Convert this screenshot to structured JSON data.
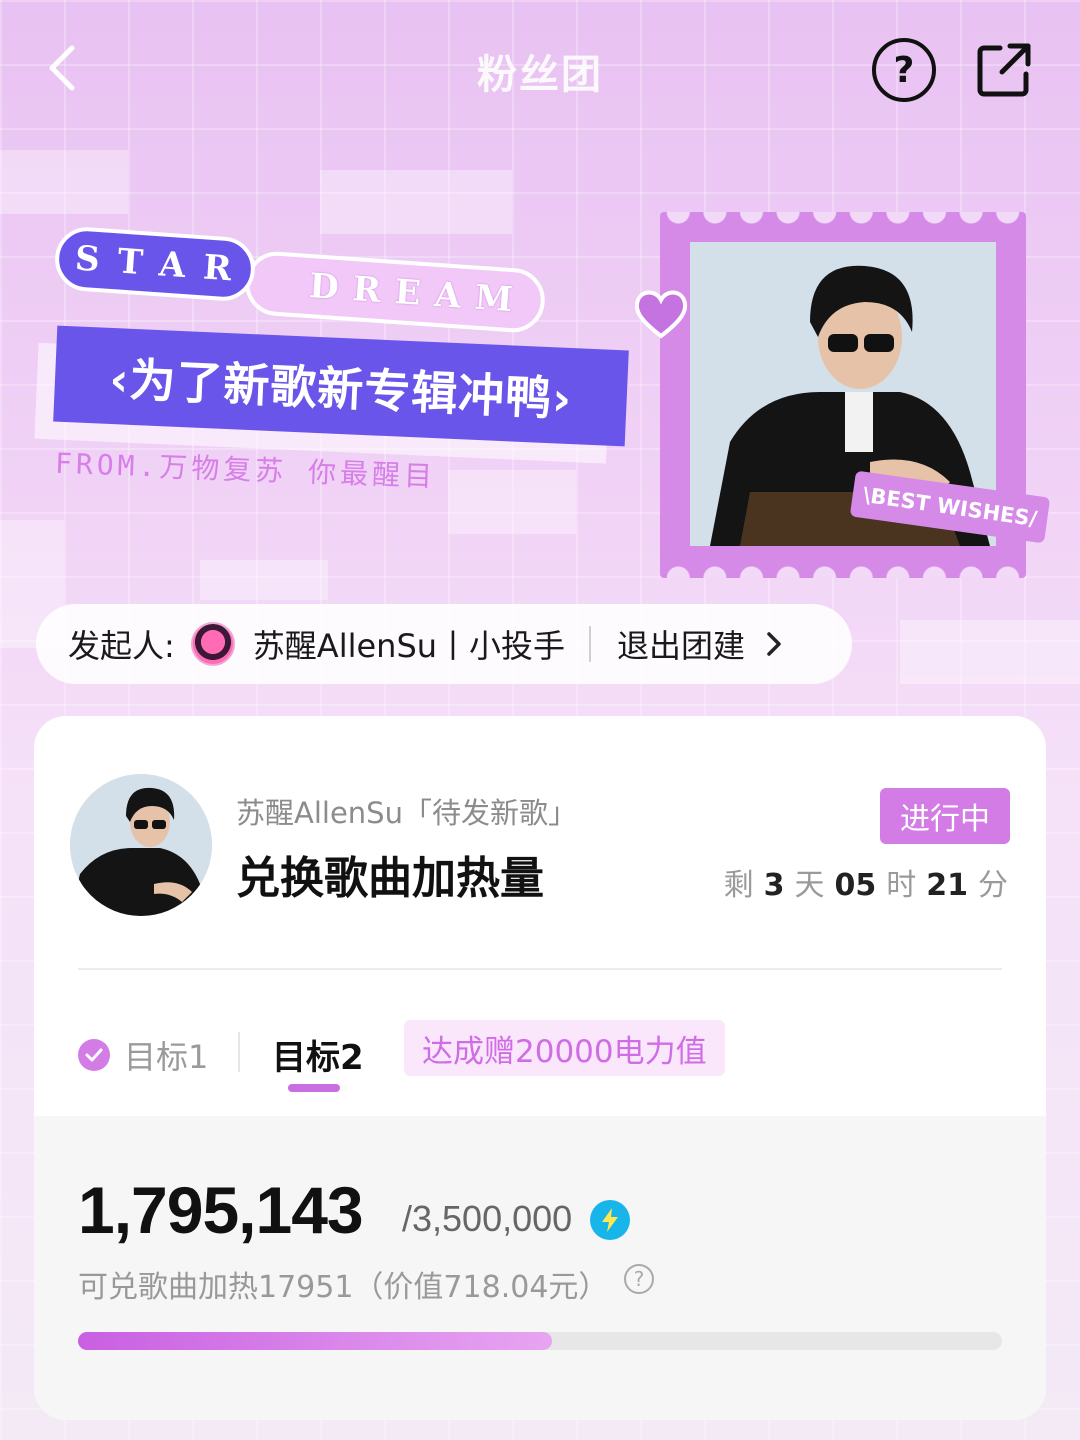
{
  "header": {
    "title": "粉丝团",
    "back_icon": "chevron-left-icon",
    "help_icon": "question-circle-icon",
    "share_icon": "share-external-icon"
  },
  "banner": {
    "tag_star": "STAR",
    "tag_dream": "DREAM",
    "slogan": "‹为了新歌新专辑冲鸭›",
    "from_text": "FROM.万物复苏 你最醒目",
    "wishes_label": "\\BEST WISHES/",
    "colors": {
      "accent": "#6a55ea",
      "stamp": "#d58ae8"
    }
  },
  "initiator": {
    "label": "发起人:",
    "name": "苏醒AllenSu丨小投手",
    "exit_label": "退出团建",
    "chevron_icon": "chevron-right-icon"
  },
  "card": {
    "subtitle": "苏醒AllenSu「待发新歌」",
    "title": "兑换歌曲加热量",
    "status": "进行中",
    "countdown": {
      "prefix": "剩",
      "days": "3",
      "days_unit": "天",
      "hours": "05",
      "hours_unit": "时",
      "minutes": "21",
      "minutes_unit": "分"
    },
    "goals": {
      "goal1_label": "目标1",
      "goal1_done": true,
      "goal2_label": "目标2",
      "reward_label": "达成赠20000电力值"
    },
    "progress": {
      "current": "1,795,143",
      "target": "/3,500,000",
      "fraction": 0.513,
      "redeem_text": "可兑歌曲加热17951（价值718.04元）",
      "bolt_icon": "lightning-icon",
      "info_icon": "question-circle-icon",
      "fill_color": "#c95fe2"
    }
  }
}
